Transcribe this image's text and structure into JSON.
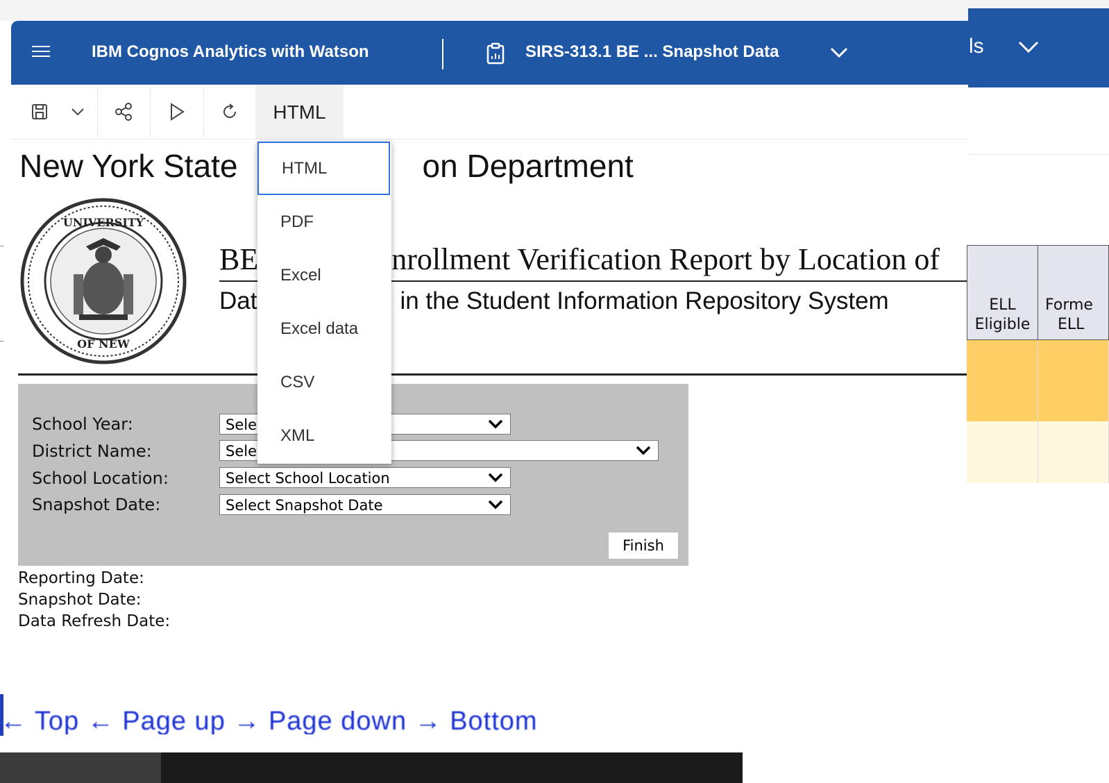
{
  "header": {
    "app_title": "IBM Cognos Analytics with Watson",
    "report_title": "SIRS-313.1 BE ... Snapshot Data",
    "right_fragment": "ls"
  },
  "toolbar": {
    "format_label": "HTML"
  },
  "format_menu": {
    "items": [
      "HTML",
      "PDF",
      "Excel",
      "Excel data",
      "CSV",
      "XML"
    ],
    "selected": "HTML"
  },
  "report": {
    "page_title_left": "New York State",
    "page_title_right": "on Department",
    "main_title_left": "BE",
    "main_title_right": "nrollment Verification Report by Location of",
    "subtitle_left": "Dat",
    "subtitle_right": "in the Student Information Repository System"
  },
  "prompts": {
    "school_year_label": "School Year:",
    "school_year_value": "Sele",
    "district_label": "District Name:",
    "district_value": "Sele",
    "location_label": "School Location:",
    "location_value": "Select School Location",
    "snapshot_label": "Snapshot Date:",
    "snapshot_value": "Select Snapshot Date",
    "finish_label": "Finish"
  },
  "info": {
    "reporting_date": "Reporting Date:",
    "snapshot_date": "Snapshot Date:",
    "refresh_date": "Data Refresh Date:"
  },
  "table": {
    "col1_line1": "ELL",
    "col1_line2": "Eligible",
    "col2_line1": "Forme",
    "col2_line2": "ELL",
    "row1_color": "#ffcf66",
    "row2_color": "#fff8df"
  },
  "footer_nav": "← Top ← Page up → Page down → Bottom",
  "colors": {
    "header_blue": "#1f57a5",
    "menu_focus": "#2f72e0",
    "prompt_gray": "#c0c0c0"
  }
}
